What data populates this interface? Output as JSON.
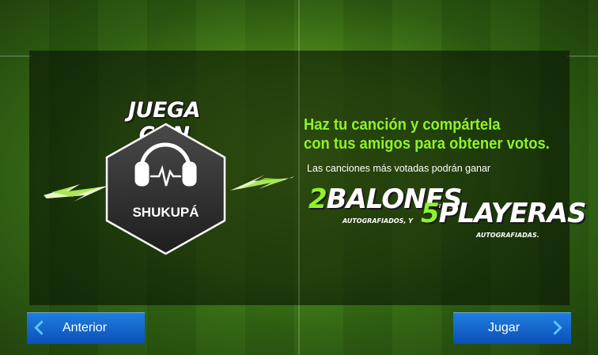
{
  "badge": {
    "top_title": "JUEGA CON",
    "name": "SHUKUPÁ",
    "icon": "headphones-icon"
  },
  "promo": {
    "headline_line1": "Haz tu canción y compártela",
    "headline_line2": "con tus amigos para obtener votos.",
    "subline": "Las canciones más votadas podrán ganar",
    "prize1_num": "2",
    "prize1_word": "BALONES",
    "prize1_sub": "AUTOGRAFIADOS, Y",
    "prize2_num": "5",
    "prize2_word": "PLAYERAS",
    "prize2_sub": "AUTOGRAFIADAS."
  },
  "nav": {
    "prev_label": "Anterior",
    "next_label": "Jugar"
  },
  "colors": {
    "accent_green": "#8ff22a",
    "button_blue": "#1f7fe0"
  }
}
